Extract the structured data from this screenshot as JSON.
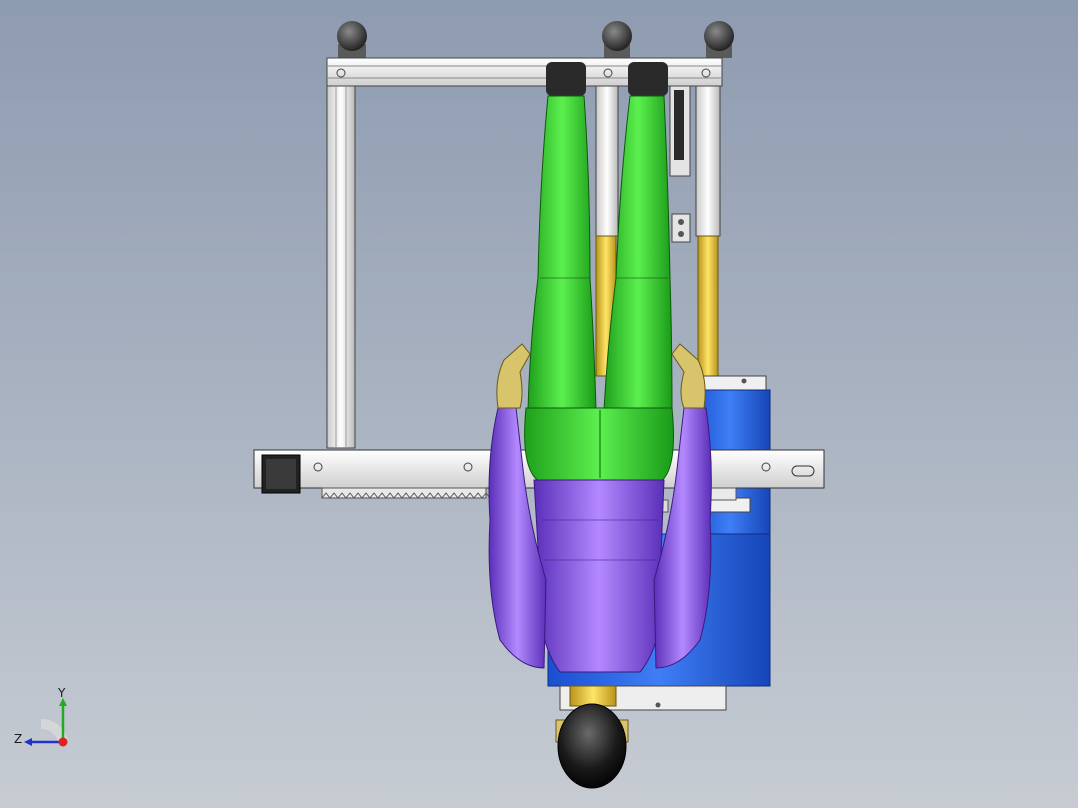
{
  "viewport": {
    "background_top": "#8e9bb0",
    "background_bottom": "#c7ccd3"
  },
  "colors": {
    "legs": "#2ed12a",
    "torso": "#8a55e0",
    "cabinet": "#1f5ee8",
    "hydraulic": "#e8c52a",
    "frame": "#e6e6e6",
    "head": "#1a1a1a",
    "gloves": "#d8c46a"
  },
  "triad": {
    "x_label": "",
    "y_label": "Y",
    "z_label": "Z",
    "y_color": "#22aa22",
    "z_color": "#2233cc",
    "x_color": "#dd2222"
  },
  "icons": [
    "axis-triad-icon"
  ]
}
